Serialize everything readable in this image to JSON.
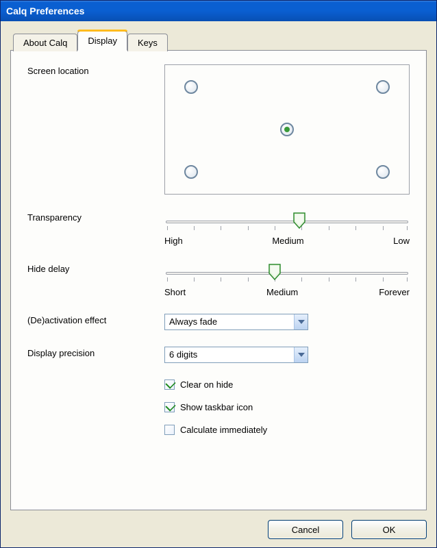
{
  "window": {
    "title": "Calq Preferences"
  },
  "tabs": [
    {
      "label": "About Calq",
      "active": false
    },
    {
      "label": "Display",
      "active": true
    },
    {
      "label": "Keys",
      "active": false
    }
  ],
  "screen_location": {
    "label": "Screen location",
    "selected": "center"
  },
  "transparency": {
    "label": "Transparency",
    "labels": {
      "left": "High",
      "mid": "Medium",
      "right": "Low"
    },
    "value_pct": 55
  },
  "hide_delay": {
    "label": "Hide delay",
    "labels": {
      "left": "Short",
      "mid": "Medium",
      "right": "Forever"
    },
    "value_pct": 45
  },
  "effect": {
    "label": "(De)activation effect",
    "selected": "Always fade"
  },
  "precision": {
    "label": "Display precision",
    "selected": "6 digits"
  },
  "checks": {
    "clear_on_hide": {
      "label": "Clear on hide",
      "checked": true
    },
    "show_taskbar": {
      "label": "Show taskbar icon",
      "checked": true
    },
    "calc_immediate": {
      "label": "Calculate immediately",
      "checked": false
    }
  },
  "buttons": {
    "cancel": "Cancel",
    "ok": "OK"
  }
}
